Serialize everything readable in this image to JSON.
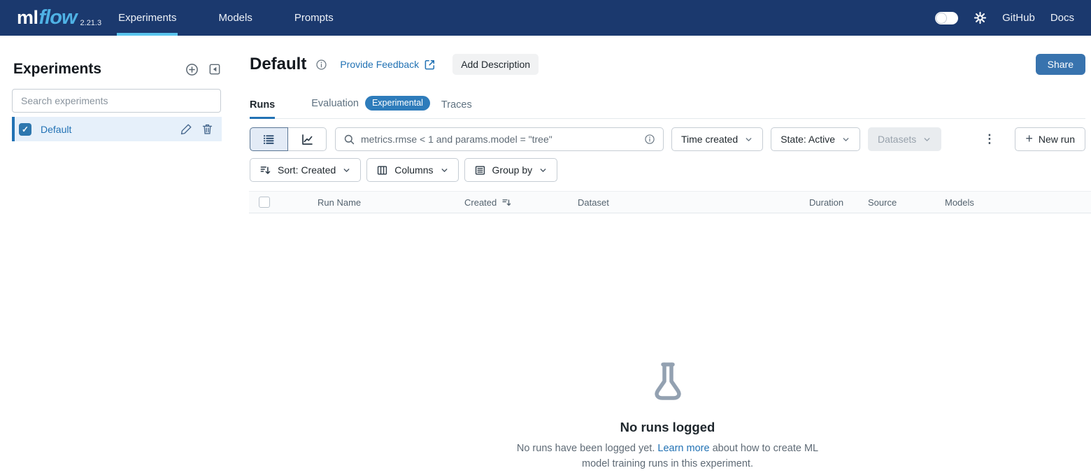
{
  "navbar": {
    "logo": {
      "ml": "ml",
      "flow": "flow",
      "version": "2.21.3"
    },
    "tabs": [
      {
        "label": "Experiments",
        "active": true
      },
      {
        "label": "Models",
        "active": false
      },
      {
        "label": "Prompts",
        "active": false
      }
    ],
    "links": {
      "github": "GitHub",
      "docs": "Docs"
    }
  },
  "sidebar": {
    "title": "Experiments",
    "search_placeholder": "Search experiments",
    "items": [
      {
        "label": "Default",
        "selected": true
      }
    ]
  },
  "main": {
    "header": {
      "title": "Default",
      "feedback_link": "Provide Feedback",
      "add_description_label": "Add Description",
      "share_label": "Share"
    },
    "tabs": [
      {
        "label": "Runs",
        "active": true
      },
      {
        "label": "Evaluation",
        "badge": "Experimental",
        "active": false
      },
      {
        "label": "Traces",
        "active": false
      }
    ],
    "toolbar": {
      "search_placeholder": "metrics.rmse < 1 and params.model = \"tree\"",
      "filters": [
        {
          "label": "Time created",
          "disabled": false
        },
        {
          "label": "State: Active",
          "disabled": false
        },
        {
          "label": "Datasets",
          "disabled": true
        }
      ],
      "new_run_label": "New run"
    },
    "toolbar2": [
      {
        "label": "Sort: Created"
      },
      {
        "label": "Columns"
      },
      {
        "label": "Group by"
      }
    ],
    "table": {
      "columns": [
        "Run Name",
        "Created",
        "Dataset",
        "Duration",
        "Source",
        "Models"
      ]
    },
    "empty_state": {
      "title": "No runs logged",
      "text_before": "No runs have been logged yet. ",
      "link": "Learn more",
      "text_after": " about how to create ML model training runs in this experiment."
    }
  },
  "icons": {
    "kebab": "⋮",
    "plus": "+",
    "check": "✓"
  },
  "colors": {
    "navbar_bg": "#1b396e",
    "navbar_active_underline": "#59c5ee",
    "logo_flow": "#4fb2e5",
    "accent_blue": "#2272b4",
    "badge_bg": "#2e7cbb",
    "share_bg": "#3873ae",
    "selected_row_bg": "#e6f0fa",
    "table_header_bg": "#fafbfc",
    "empty_icon": "#93a1b1"
  }
}
